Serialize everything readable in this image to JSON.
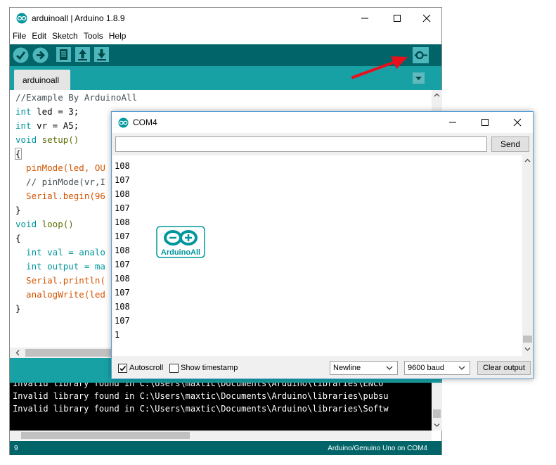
{
  "ide": {
    "title": "arduinoall | Arduino 1.8.9",
    "menu": [
      "File",
      "Edit",
      "Sketch",
      "Tools",
      "Help"
    ],
    "tab": "arduinoall",
    "code": [
      "//Example By ArduinoAll",
      "int led = 3;",
      "int vr = A5;",
      "void setup()",
      "{",
      "  pinMode(led, OU",
      "  // pinMode(vr,I",
      "  Serial.begin(96",
      "}",
      "void loop()",
      "{",
      "  int val = analo",
      "  int output = ma",
      "  Serial.println(",
      "  analogWrite(led",
      "}"
    ],
    "console": [
      "Invalid library found in C:\\Users\\maxtic\\Documents\\Arduino\\libraries\\ENCO",
      "Invalid library found in C:\\Users\\maxtic\\Documents\\Arduino\\libraries\\pubsu",
      "Invalid library found in C:\\Users\\maxtic\\Documents\\Arduino\\libraries\\Softw"
    ],
    "footer_line": "9",
    "footer_board": "Arduino/Genuino Uno on COM4"
  },
  "serial": {
    "title": "COM4",
    "input_value": "",
    "send_label": "Send",
    "output": [
      "108",
      "107",
      "108",
      "107",
      "108",
      "107",
      "108",
      "107",
      "108",
      "107",
      "108",
      "107",
      "1"
    ],
    "watermark": "ArduinoAll",
    "autoscroll_label": "Autoscroll",
    "autoscroll_checked": true,
    "timestamp_label": "Show timestamp",
    "timestamp_checked": false,
    "line_ending": "Newline",
    "baud": "9600 baud",
    "clear_label": "Clear output"
  },
  "colors": {
    "toolbar": "#006468",
    "tabstrip": "#17a1a5",
    "annotation_arrow": "#e8101a"
  }
}
